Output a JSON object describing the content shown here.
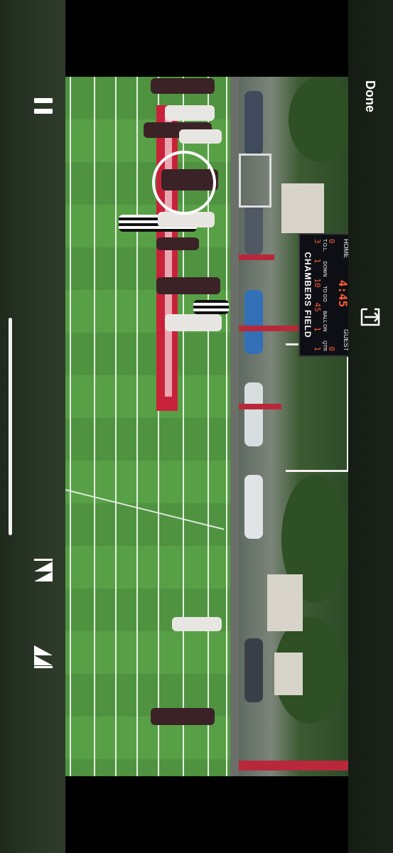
{
  "player": {
    "done_label": "Done",
    "icons": [
      "pause-icon",
      "skip-back-icon",
      "skip-forward-icon",
      "share-icon"
    ]
  },
  "scoreboard": {
    "time": "4:45",
    "home_score": "0",
    "guest_score": "0",
    "venue": "CHAMBERS FIELD",
    "labels": {
      "home": "HOME",
      "guest": "GUEST",
      "tol": "T.O.L.",
      "down": "DOWN",
      "to_go": "TO GO",
      "ball_on": "BALL ON",
      "qtr": "QTR"
    },
    "values": {
      "tol_home": "3",
      "tol_guest": "1",
      "down": "1",
      "to_go": "10",
      "ball_on": "45",
      "qtr": "1"
    }
  },
  "colors": {
    "accent": "#c8223a",
    "field": "#4f9340",
    "controls_bg": "#2a3727"
  }
}
